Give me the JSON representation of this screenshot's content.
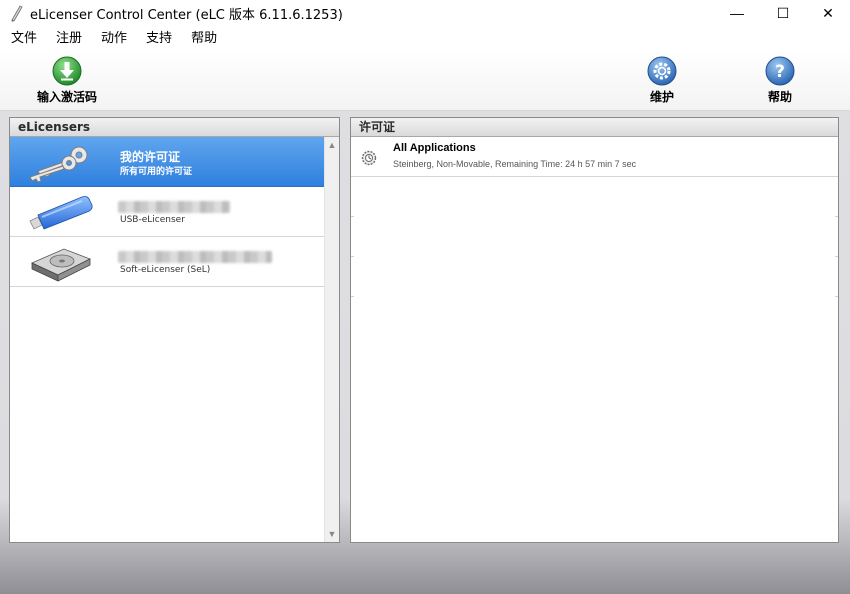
{
  "window": {
    "title": "eLicenser Control Center (eLC 版本 6.11.6.1253)",
    "minimize_glyph": "—",
    "maximize_glyph": "☐",
    "close_glyph": "✕"
  },
  "menu": {
    "items": [
      "文件",
      "注册",
      "动作",
      "支持",
      "帮助"
    ]
  },
  "toolbar": {
    "enter_code_label": "输入激活码",
    "maintenance_label": "维护",
    "help_label": "帮助"
  },
  "left_panel": {
    "header": "eLicensers",
    "items": [
      {
        "title": "我的许可证",
        "subtitle": "所有可用的许可证",
        "icon": "keys-icon"
      },
      {
        "title": "",
        "subtitle": "USB-eLicenser",
        "icon": "usb-stick-icon"
      },
      {
        "title": "",
        "subtitle": "Soft-eLicenser (SeL)",
        "icon": "hard-drive-icon"
      }
    ]
  },
  "right_panel": {
    "header": "许可证",
    "licenses": [
      {
        "name": "All Applications",
        "detail": "Steinberg, Non-Movable, Remaining Time: 24 h 57 min 7 sec",
        "icon": "gear-clock-icon"
      }
    ]
  },
  "colors": {
    "selection_top": "#5fa6ee",
    "selection_bottom": "#2f7fde",
    "enter_code_icon": "#2fa33b",
    "toolbar_blue_icons": "#3b7fc9"
  }
}
